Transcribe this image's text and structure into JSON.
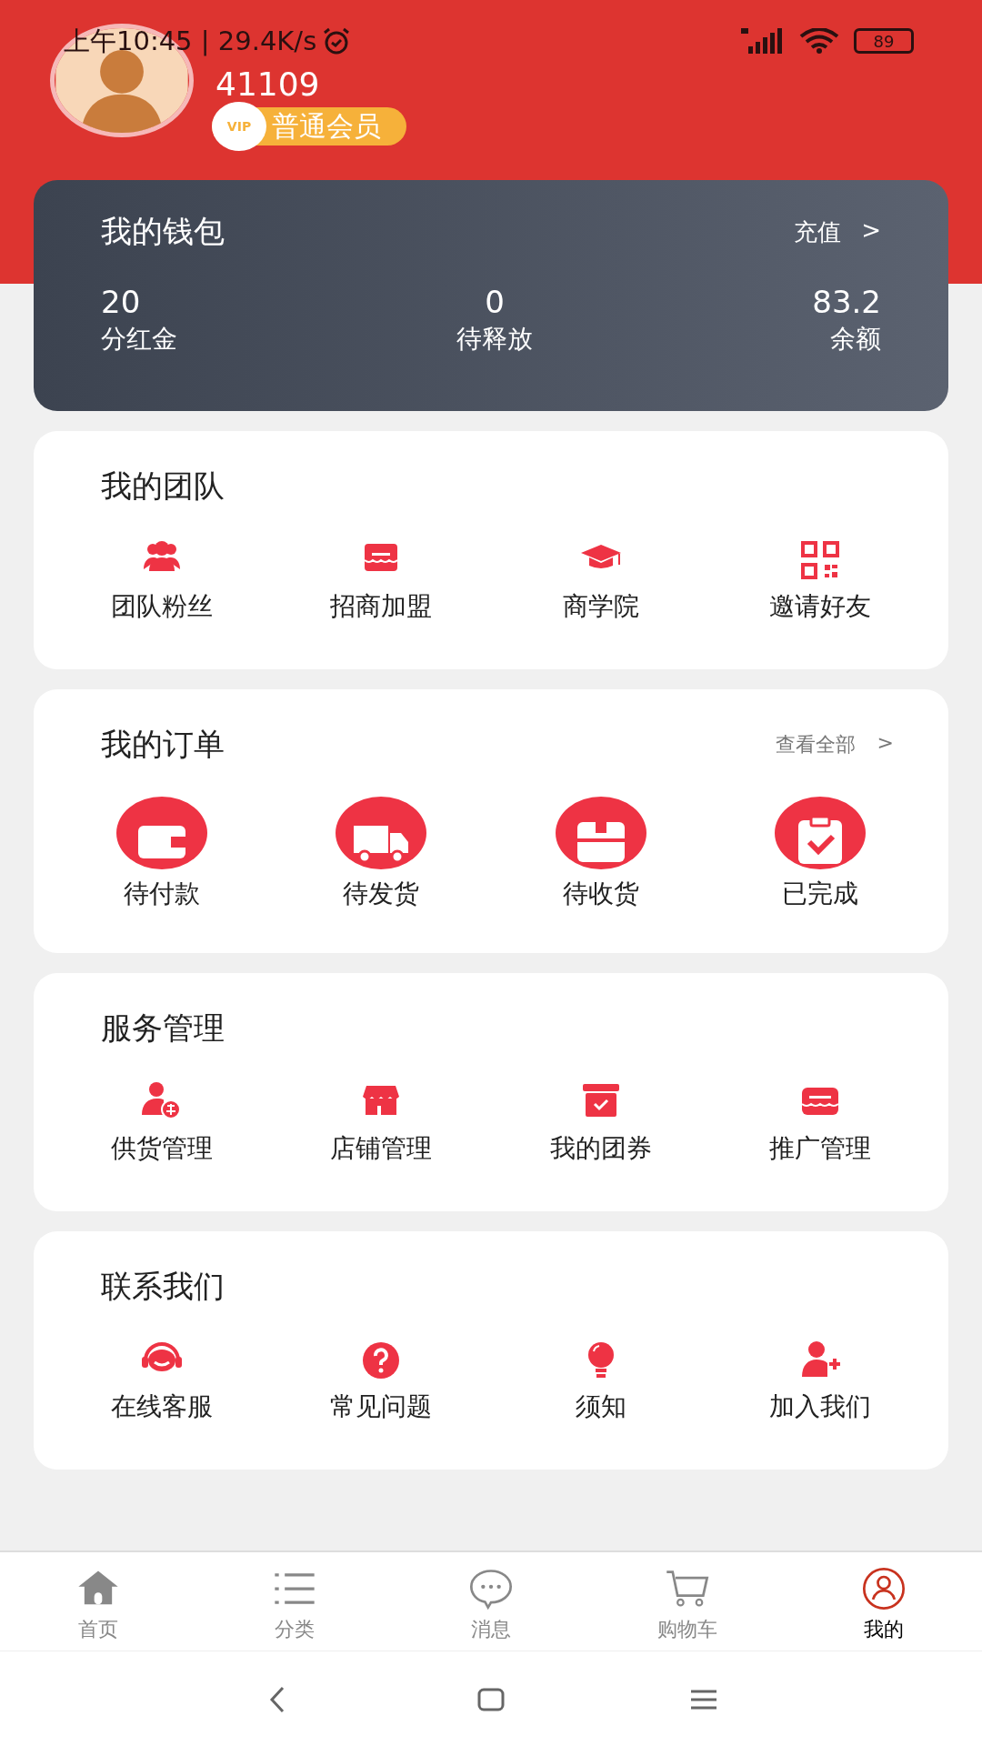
{
  "status_bar": {
    "time": "上午10:45 | 29.4K/s",
    "battery": "89"
  },
  "profile": {
    "user_id": "41109",
    "badge_icon": "VIP",
    "member_level": "普通会员"
  },
  "wallet": {
    "title": "我的钱包",
    "action": "充值",
    "chevron": ">",
    "stats": [
      {
        "value": "20",
        "label": "分红金"
      },
      {
        "value": "0",
        "label": "待释放"
      },
      {
        "value": "83.2",
        "label": "余额"
      }
    ]
  },
  "sections": [
    {
      "title": "我的团队",
      "kind": "plain",
      "items": [
        {
          "label": "团队粉丝"
        },
        {
          "label": "招商加盟"
        },
        {
          "label": "商学院"
        },
        {
          "label": "邀请好友"
        }
      ]
    },
    {
      "title": "我的订单",
      "kind": "circle",
      "link": "查看全部",
      "chevron": ">",
      "items": [
        {
          "label": "待付款"
        },
        {
          "label": "待发货"
        },
        {
          "label": "待收货"
        },
        {
          "label": "已完成"
        }
      ]
    },
    {
      "title": "服务管理",
      "kind": "plain",
      "items": [
        {
          "label": "供货管理"
        },
        {
          "label": "店铺管理"
        },
        {
          "label": "我的团券"
        },
        {
          "label": "推广管理"
        }
      ]
    },
    {
      "title": "联系我们",
      "kind": "plain",
      "items": [
        {
          "label": "在线客服"
        },
        {
          "label": "常见问题"
        },
        {
          "label": "须知"
        },
        {
          "label": "加入我们"
        }
      ]
    }
  ],
  "nav": [
    {
      "label": "首页",
      "selected": false
    },
    {
      "label": "分类",
      "selected": false
    },
    {
      "label": "消息",
      "selected": false
    },
    {
      "label": "购物车",
      "selected": false
    },
    {
      "label": "我的",
      "selected": true
    }
  ]
}
